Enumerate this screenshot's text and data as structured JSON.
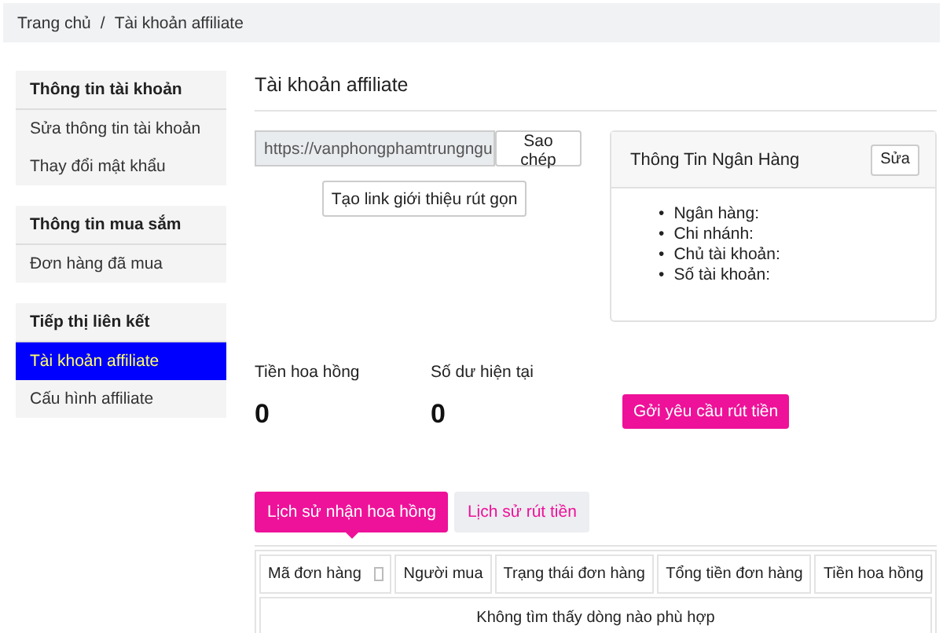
{
  "breadcrumb": [
    {
      "label": "Trang chủ"
    },
    {
      "label": "Tài khoản affiliate"
    }
  ],
  "breadcrumb_separator": "/",
  "sidebar": {
    "groups": [
      {
        "title": "Thông tin tài khoản",
        "items": [
          {
            "label": "Sửa thông tin tài khoản",
            "selected": false
          },
          {
            "label": "Thay đổi mật khẩu",
            "selected": false
          }
        ]
      },
      {
        "title": "Thông tin mua sắm",
        "items": [
          {
            "label": "Đơn hàng đã mua",
            "selected": false
          }
        ]
      },
      {
        "title": "Tiếp thị liên kết",
        "items": [
          {
            "label": "Tài khoản affiliate",
            "selected": true
          },
          {
            "label": "Cấu hình affiliate",
            "selected": false
          }
        ]
      }
    ]
  },
  "page_title": "Tài khoản affiliate",
  "referral": {
    "url": "https://vanphongphamtrungngu",
    "copy_button": "Sao chép",
    "shorten_button": "Tạo link giới thiệu rút gọn"
  },
  "bank_card": {
    "title": "Thông Tin Ngân Hàng",
    "edit_button": "Sửa",
    "bullet": "•",
    "fields": [
      "Ngân hàng:",
      "Chi nhánh:",
      "Chủ tài khoản:",
      "Số tài khoản:"
    ]
  },
  "stats": [
    {
      "label": "Tiền hoa hồng",
      "value": "0"
    },
    {
      "label": "Số dư hiện tại",
      "value": "0"
    }
  ],
  "withdraw_button": "Gởi yêu cầu rút tiền",
  "tabs": [
    {
      "label": "Lịch sử nhận hoa hồng",
      "selected": true
    },
    {
      "label": "Lịch sử rút tiền",
      "selected": false
    }
  ],
  "table": {
    "columns": [
      {
        "label": "Mã đơn hàng",
        "sortable": true
      },
      {
        "label": "Người mua",
        "sortable": false
      },
      {
        "label": "Trạng thái đơn hàng",
        "sortable": false
      },
      {
        "label": "Tổng tiền đơn hàng",
        "sortable": false
      },
      {
        "label": "Tiền hoa hồng",
        "sortable": false
      }
    ],
    "empty_message": "Không tìm thấy dòng nào phù hợp"
  }
}
